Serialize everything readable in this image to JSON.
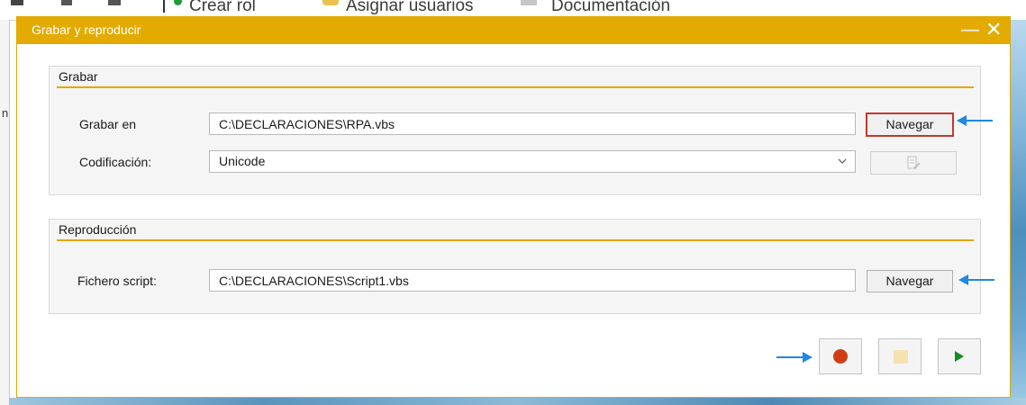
{
  "background": {
    "toolbar_items": [
      {
        "label": "Crear rol"
      },
      {
        "label": "Asignar usuarios"
      },
      {
        "label": "Documentación"
      }
    ],
    "left_fragment": "n"
  },
  "dialog": {
    "title": "Grabar y reproducir",
    "minimize_glyph": "—",
    "close_glyph": "✕"
  },
  "grabar": {
    "section_title": "Grabar",
    "path_label": "Grabar en",
    "path_value": "C:\\DECLARACIONES\\RPA.vbs",
    "browse_label": "Navegar",
    "encoding_label": "Codificación:",
    "encoding_value": "Unicode",
    "edit_icon": "edit-document-icon"
  },
  "reproduccion": {
    "section_title": "Reproducción",
    "script_label": "Fichero script:",
    "script_value": "C:\\DECLARACIONES\\Script1.vbs",
    "browse_label": "Navegar"
  },
  "actions": {
    "record_icon": "record-icon",
    "stop_icon": "stop-icon",
    "play_icon": "play-icon"
  },
  "colors": {
    "accent": "#e3ab00",
    "record": "#cf3d12",
    "play": "#178a2c",
    "annotation": "#1e88e5",
    "focus": "#c0392b"
  }
}
